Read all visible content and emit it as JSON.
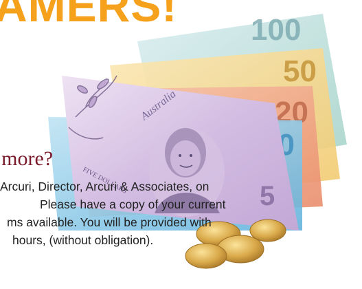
{
  "headline": {
    "text": "AMERS!"
  },
  "subheading": {
    "text": "ow more?"
  },
  "body": {
    "lines": [
      "Arcuri, Director, Arcuri & Associates, on",
      "Please have a copy of your current",
      "ms available.  You will be provided with",
      "hours, (without obligation)."
    ]
  },
  "banknotes": {
    "note_100": "100",
    "note_50": "50",
    "note_20": "20",
    "note_10": "10",
    "note_5": "5",
    "country_text": "Australia",
    "denomination_text": "FIVE DOLLARS"
  },
  "colors": {
    "headline": "#f5a11c",
    "subheading": "#7a1a2a",
    "body_text": "#222222",
    "note_5": "#c9b3dc",
    "note_10": "#7fc4e6",
    "note_20": "#f0a080",
    "note_50": "#f4d27a",
    "note_100": "#a8d8c0",
    "coin": "#d9a94a"
  }
}
